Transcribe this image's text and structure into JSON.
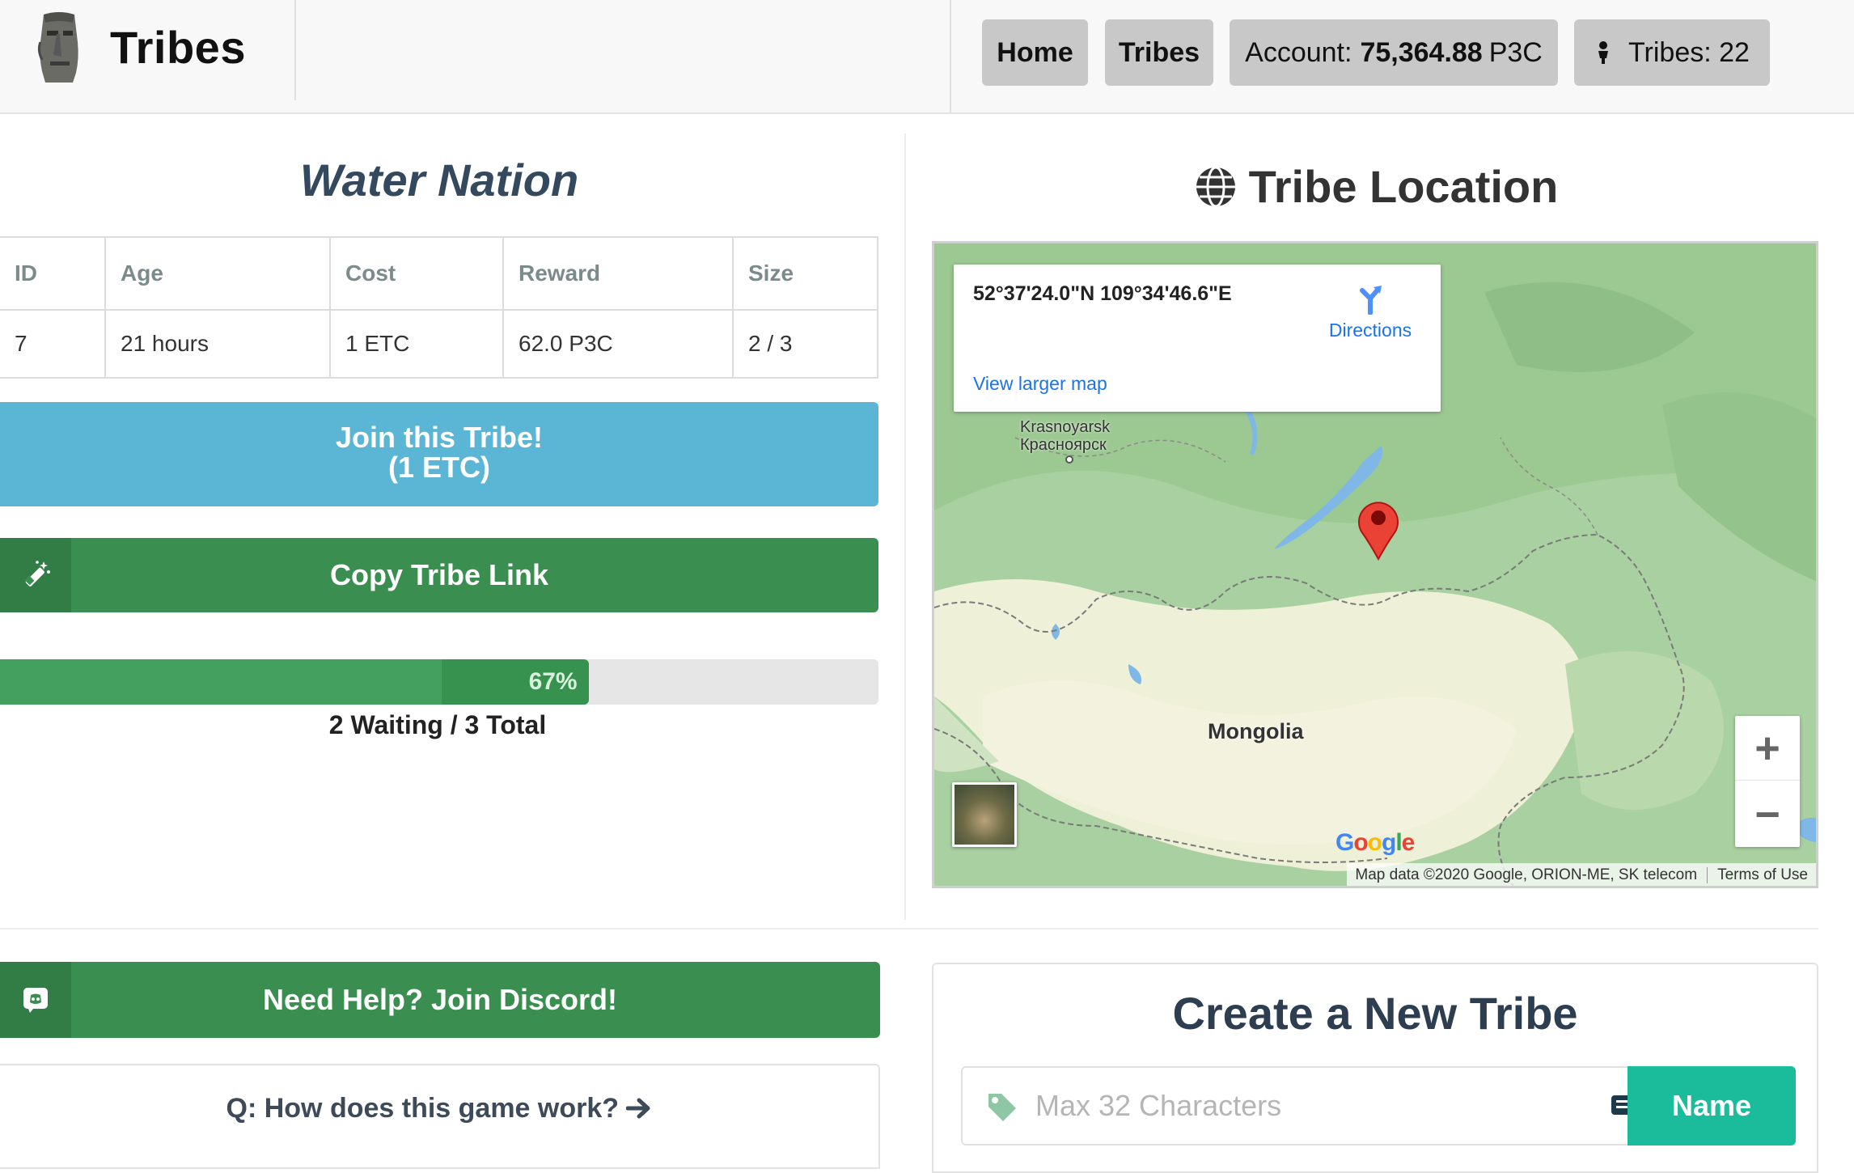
{
  "header": {
    "brand_title": "Tribes",
    "nav": {
      "home": "Home",
      "tribes": "Tribes",
      "account_prefix": "Account:",
      "account_amount": "75,364.88",
      "account_unit": "P3C",
      "tribe_count_label": "Tribes: 22"
    }
  },
  "tribe": {
    "name": "Water Nation",
    "table": {
      "headers": [
        "ID",
        "Age",
        "Cost",
        "Reward",
        "Size"
      ],
      "row": [
        "7",
        "21 hours",
        "1 ETC",
        "62.0 P3C",
        "2 / 3"
      ]
    },
    "join_line1": "Join this Tribe!",
    "join_line2": "(1 ETC)",
    "copy_link": "Copy Tribe Link",
    "progress_percent": 67,
    "progress_label": "67%",
    "progress_caption": "2 Waiting / 3 Total"
  },
  "help": {
    "discord": "Need Help? Join Discord!",
    "faq": "Q: How does this game work?"
  },
  "location": {
    "title": "Tribe Location",
    "coords": "52°37'24.0\"N 109°34'46.6\"E",
    "directions": "Directions",
    "view_larger": "View larger map",
    "city_en": "Krasnoyarsk",
    "city_ru": "Красноярск",
    "country": "Mongolia",
    "google": "Google",
    "attribution": "Map data ©2020 Google, ORION-ME, SK telecom",
    "terms": "Terms of Use",
    "zoom_in": "+",
    "zoom_out": "−"
  },
  "create": {
    "title": "Create a New Tribe",
    "placeholder": "Max 32 Characters",
    "name_button": "Name"
  },
  "colors": {
    "join_button": "#5bb5d5",
    "green_button": "#3a8f50",
    "progress": "#44a05e",
    "name_button": "#1abc9c",
    "title_blue": "#34495e"
  }
}
